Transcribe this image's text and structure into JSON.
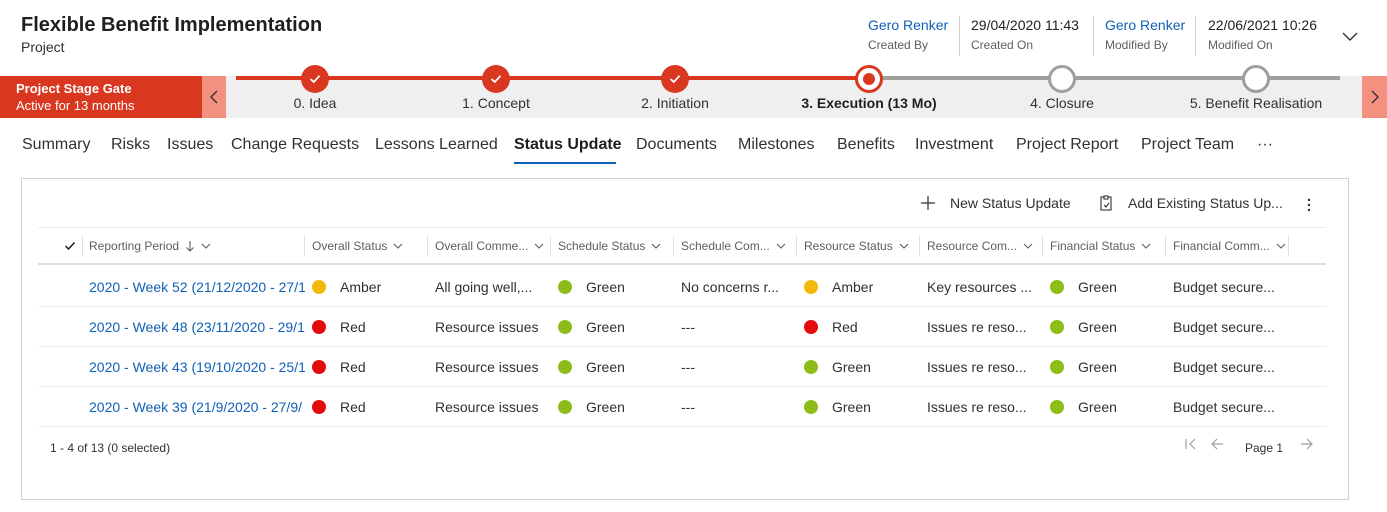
{
  "header": {
    "title": "Flexible Benefit Implementation",
    "subtitle": "Project",
    "created_by": {
      "value": "Gero Renker",
      "label": "Created By"
    },
    "created_on": {
      "value": "29/04/2020 11:43",
      "label": "Created On"
    },
    "modified_by": {
      "value": "Gero Renker",
      "label": "Modified By"
    },
    "modified_on": {
      "value": "22/06/2021 10:26",
      "label": "Modified On"
    }
  },
  "stagegate": {
    "title": "Project Stage Gate",
    "status": "Active for 13 months"
  },
  "stages": [
    {
      "label": "0. Idea",
      "state": "done"
    },
    {
      "label": "1. Concept",
      "state": "done"
    },
    {
      "label": "2. Initiation",
      "state": "done"
    },
    {
      "label": "3. Execution  (13 Mo)",
      "state": "active"
    },
    {
      "label": "4. Closure",
      "state": "pending"
    },
    {
      "label": "5. Benefit Realisation",
      "state": "pending"
    }
  ],
  "tabs": [
    "Summary",
    "Risks",
    "Issues",
    "Change Requests",
    "Lessons Learned",
    "Status Update",
    "Documents",
    "Milestones",
    "Benefits",
    "Investment",
    "Project Report",
    "Project Team",
    "···"
  ],
  "active_tab": "Status Update",
  "commands": {
    "new": "New Status Update",
    "add_existing": "Add Existing Status Up..."
  },
  "columns": [
    "Reporting Period",
    "Overall Status",
    "Overall Comme...",
    "Schedule Status",
    "Schedule Com...",
    "Resource Status",
    "Resource Com...",
    "Financial Status",
    "Financial Comm..."
  ],
  "rows": [
    {
      "period": "2020 - Week 52 (21/12/2020 - 27/1",
      "overall": "Amber",
      "overall_comment": "All going well,...",
      "schedule": "Green",
      "schedule_comment": "No concerns r...",
      "resource": "Amber",
      "resource_comment": "Key resources ...",
      "financial": "Green",
      "financial_comment": "Budget secure..."
    },
    {
      "period": "2020 - Week 48 (23/11/2020 - 29/1",
      "overall": "Red",
      "overall_comment": "Resource issues",
      "schedule": "Green",
      "schedule_comment": "---",
      "resource": "Red",
      "resource_comment": "Issues re reso...",
      "financial": "Green",
      "financial_comment": "Budget secure..."
    },
    {
      "period": "2020 - Week 43 (19/10/2020 - 25/1",
      "overall": "Red",
      "overall_comment": "Resource issues",
      "schedule": "Green",
      "schedule_comment": "---",
      "resource": "Green",
      "resource_comment": "Issues re reso...",
      "financial": "Green",
      "financial_comment": "Budget secure..."
    },
    {
      "period": "2020 - Week 39 (21/9/2020 - 27/9/",
      "overall": "Red",
      "overall_comment": "Resource issues",
      "schedule": "Green",
      "schedule_comment": "---",
      "resource": "Green",
      "resource_comment": "Issues re reso...",
      "financial": "Green",
      "financial_comment": "Budget secure..."
    }
  ],
  "status_colors": {
    "Green": "#8cbd18",
    "Amber": "#f2b90b",
    "Red": "#e30c0c"
  },
  "footer": {
    "count": "1 - 4 of 13 (0 selected)",
    "page": "Page 1"
  },
  "colors": {
    "accent": "#d9371f",
    "link": "#1160b7"
  }
}
